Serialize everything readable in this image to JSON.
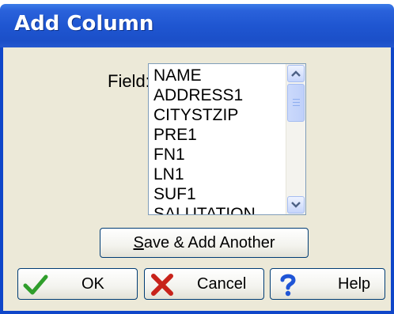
{
  "window": {
    "title": "Add Column"
  },
  "field": {
    "label": "Field:",
    "items": [
      "NAME",
      "ADDRESS1",
      "CITYSTZIP",
      "PRE1",
      "FN1",
      "LN1",
      "SUF1",
      "SALUTATION"
    ]
  },
  "buttons": {
    "save_add_another": {
      "mnemonic": "S",
      "rest": "ave & Add Another"
    },
    "ok": "OK",
    "cancel": "Cancel",
    "help": "Help"
  },
  "colors": {
    "titlebar": "#1f56d1",
    "client": "#ece9d8",
    "ok_check": "#2f9e2b",
    "cancel_x": "#c8231b",
    "help_q": "#1f55d6"
  },
  "icons": {
    "ok": "check-icon",
    "cancel": "x-icon",
    "help": "question-mark-icon",
    "scroll_up": "chevron-up-icon",
    "scroll_down": "chevron-down-icon"
  }
}
